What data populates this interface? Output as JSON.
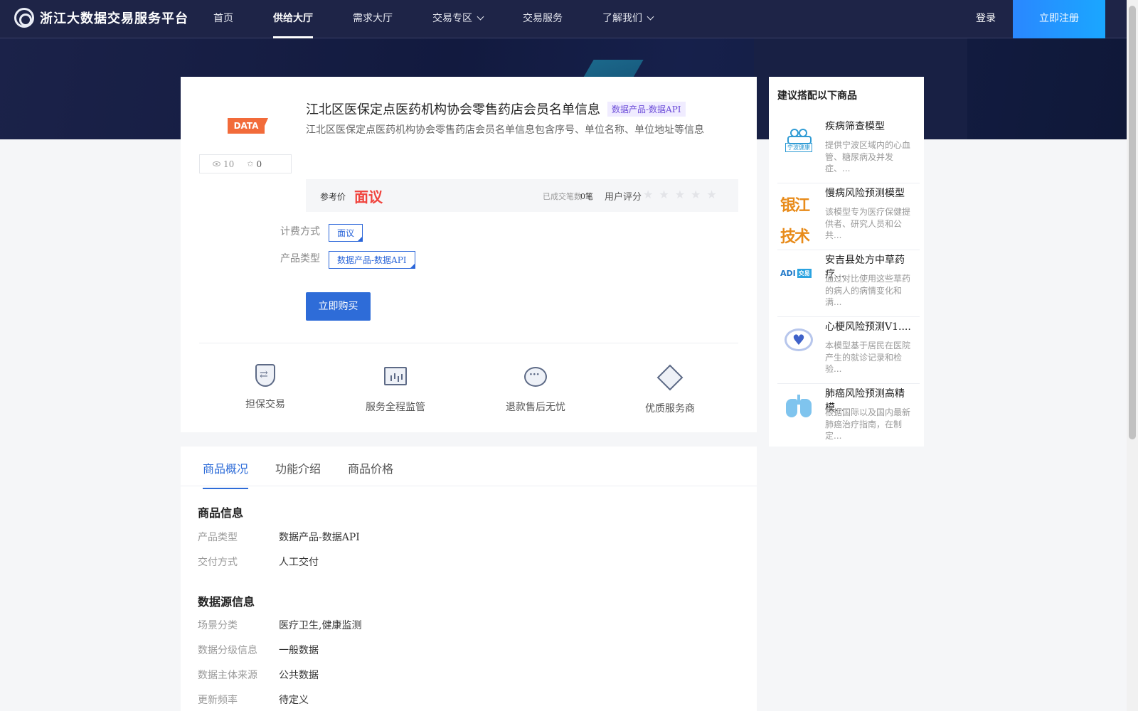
{
  "header": {
    "logo_text": "浙江大数据交易服务平台",
    "nav": [
      {
        "label": "首页"
      },
      {
        "label": "供给大厅"
      },
      {
        "label": "需求大厅"
      },
      {
        "label": "交易专区"
      },
      {
        "label": "交易服务"
      },
      {
        "label": "了解我们"
      }
    ],
    "login": "登录",
    "register": "立即注册"
  },
  "product": {
    "badge": "DATA",
    "views": "10",
    "favorites": "0",
    "title": "江北区医保定点医药机构协会零售药店会员名单信息",
    "type_tag": "数据产品-数据API",
    "description": "江北区医保定点医药机构协会零售药店会员名单信息包含序号、单位名称、单位地址等信息",
    "price_label": "参考价",
    "price": "面议",
    "tx_label": "已成交笔数",
    "tx_count": "0笔",
    "rating_label": "用户评分",
    "stars": "★★★★★",
    "billing_label": "计费方式",
    "billing_value": "面议",
    "ptype_label": "产品类型",
    "ptype_value": "数据产品-数据API",
    "buy_button": "立即购买",
    "features": [
      {
        "label": "担保交易",
        "icon": "shield-exchange-icon"
      },
      {
        "label": "服务全程监管",
        "icon": "monitor-chart-icon"
      },
      {
        "label": "退款售后无忧",
        "icon": "chat-bubble-icon"
      },
      {
        "label": "优质服务商",
        "icon": "diamond-icon"
      }
    ]
  },
  "tabs": [
    {
      "label": "商品概况"
    },
    {
      "label": "功能介绍"
    },
    {
      "label": "商品价格"
    }
  ],
  "info": {
    "section1_title": "商品信息",
    "rows1": [
      {
        "label": "产品类型",
        "value": "数据产品-数据API"
      },
      {
        "label": "交付方式",
        "value": "人工交付"
      }
    ],
    "section2_title": "数据源信息",
    "rows2": [
      {
        "label": "场景分类",
        "value": "医疗卫生,健康监测"
      },
      {
        "label": "数据分级信息",
        "value": "一般数据"
      },
      {
        "label": "数据主体来源",
        "value": "公共数据"
      },
      {
        "label": "更新频率",
        "value": "待定义"
      }
    ]
  },
  "sidebar": {
    "title": "建议搭配以下商品",
    "items": [
      {
        "name": "疾病筛查模型",
        "desc": "提供宁波区域内的心血管、糖尿病及并发症、...",
        "logo_caption": "宁波健康"
      },
      {
        "name": "慢病风险预测模型",
        "desc": "该模型专为医疗保健提供者、研究人员和公共...",
        "logo_text": "银江技术"
      },
      {
        "name": "安吉县处方中草药疗...",
        "desc": "通过对比使用这些草药的病人的病情变化和满...",
        "logo_text": "ADI",
        "logo_badge": "交易"
      },
      {
        "name": "心梗风险预测V1....",
        "desc": "本模型基于居民在医院产生的就诊记录和检验..."
      },
      {
        "name": "肺癌风险预测高精模...",
        "desc": "根据国际以及国内最新肺癌治疗指南，在制定..."
      }
    ]
  }
}
